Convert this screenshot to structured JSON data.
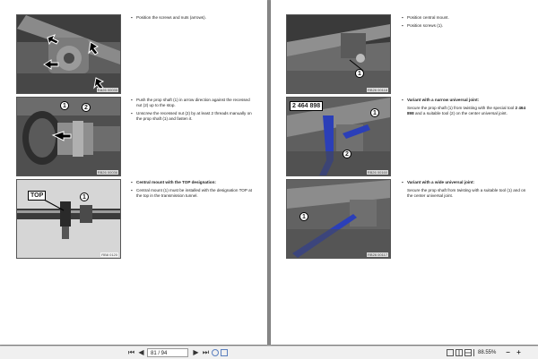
{
  "left_page": {
    "figures": [
      {
        "ref": "RB26 00035",
        "callouts": []
      },
      {
        "ref": "RB26 00036",
        "callouts": [
          "1",
          "2"
        ]
      },
      {
        "ref": "RB8 0120",
        "callouts": [
          "1"
        ],
        "tag": "TOP"
      }
    ],
    "sections": [
      {
        "paragraphs": [
          "Position the screws and nuts (arrows)."
        ]
      },
      {
        "paragraphs": [
          "Push the prop shaft (1) in arrow direction against the recessed nut (2) up to the stop.",
          "Unscrew the recessed nut (2) by at least 2 threads manually on the prop shaft (1) and fasten it."
        ]
      },
      {
        "heading": "Central mount with the TOP designation:",
        "paragraphs": [
          "Central mount (1) must be installed with the designation TOP at the top in the transmission tunnel."
        ]
      }
    ]
  },
  "right_page": {
    "figures": [
      {
        "ref": "RB26 00118",
        "callouts": [
          "1"
        ]
      },
      {
        "ref": "RB26 00160",
        "callouts": [
          "1",
          "2"
        ],
        "tag": "2 464 898"
      },
      {
        "ref": "RB26 00117",
        "callouts": [
          "1"
        ]
      }
    ],
    "sections": [
      {
        "paragraphs": [
          "Position central mount.",
          "Position screws (1)."
        ]
      },
      {
        "heading": "Variant with a narrow universal joint:",
        "paragraphs_rich": [
          {
            "before": "Secure the prop shaft (1) from twisting with the special tool ",
            "bold": "2 464 898",
            "after": " and a suitable tool (2) on the center universal joint."
          }
        ]
      },
      {
        "heading": "Variant with a wide universal joint:",
        "paragraphs": [
          "Secure the prop shaft from twisting with a suitable tool (1) and on the center universal joint."
        ]
      }
    ]
  },
  "toolbar": {
    "page_value": "81 / 94",
    "zoom": "88.55%",
    "icons": [
      "first-page-icon",
      "previous-page-icon",
      "next-page-icon",
      "last-page-icon",
      "rotate-icon",
      "copy-icon",
      "single-page-view-icon",
      "two-page-view-icon",
      "continuous-view-icon",
      "fit-width-icon",
      "zoom-out-icon",
      "zoom-in-icon"
    ]
  },
  "colors": {
    "background": "#8d8d8d",
    "toolbar": "#f0f0f0",
    "tool_blue": "#2b3fb8"
  }
}
